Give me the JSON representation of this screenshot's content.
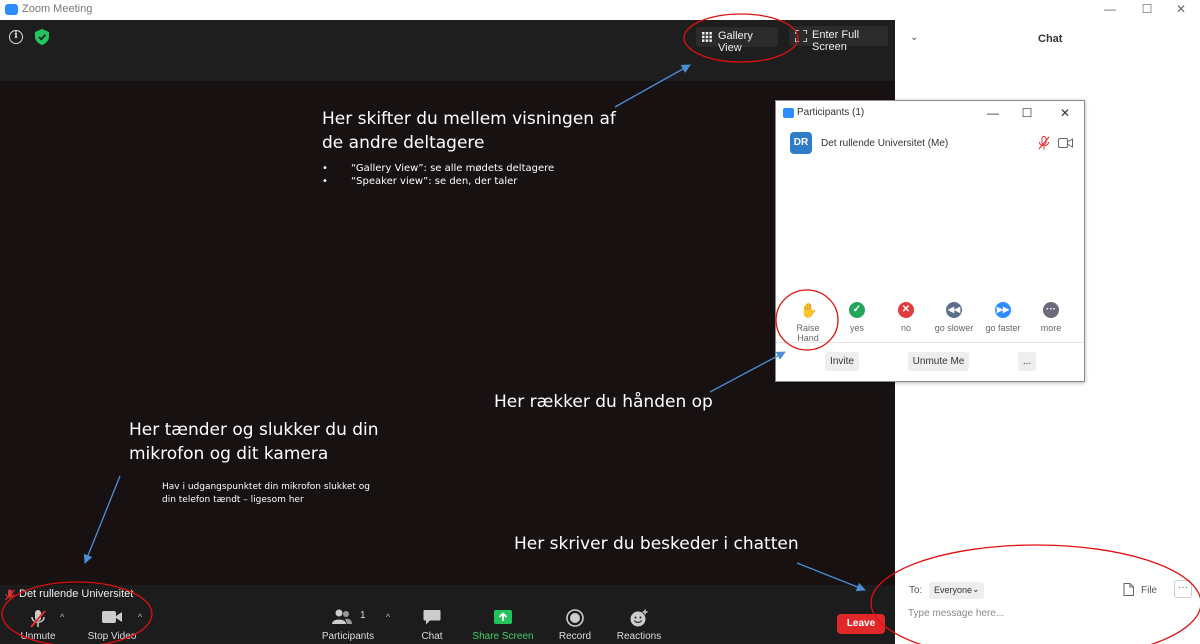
{
  "window": {
    "title": "Zoom Meeting",
    "min": "—",
    "max": "☐",
    "close": "✕"
  },
  "top_bar": {
    "gallery_view": "Gallery View",
    "full_screen": "Enter Full Screen"
  },
  "annotations": {
    "view_title": "Her skifter du mellem visningen af de andre deltagere",
    "view_bullets": [
      "“Gallery View”: se alle mødets deltagere",
      "“Speaker view”: se den, der taler"
    ],
    "hand": "Her rækker du hånden op",
    "mic_title": "Her tænder og slukker du din mikrofon og dit kamera",
    "mic_sub": "Hav i udgangspunktet din mikrofon slukket og din telefon tændt – ligesom her",
    "chat": "Her skriver du beskeder i chatten"
  },
  "self_name": "Det rullende Universitet",
  "toolbar": {
    "unmute": "Unmute",
    "stop_video": "Stop Video",
    "participants": "Participants",
    "participant_count": "1",
    "chat": "Chat",
    "share_screen": "Share Screen",
    "record": "Record",
    "reactions": "Reactions",
    "leave": "Leave"
  },
  "chat": {
    "title": "Chat",
    "to_label": "To:",
    "recipient": "Everyone",
    "file": "File",
    "more": "···",
    "placeholder": "Type message here..."
  },
  "participants": {
    "title": "Participants (1)",
    "list": [
      {
        "initials": "DR",
        "name": "Det rullende Universitet (Me)"
      }
    ],
    "feedback": [
      {
        "label": "Raise Hand",
        "color": "#2d8cff"
      },
      {
        "label": "yes",
        "color": "#23a55a"
      },
      {
        "label": "no",
        "color": "#e03c3c"
      },
      {
        "label": "go slower",
        "color": "#5b6e8c"
      },
      {
        "label": "go faster",
        "color": "#2d8cff"
      },
      {
        "label": "more",
        "color": "#6b6b7b"
      }
    ],
    "invite": "Invite",
    "unmute_me": "Unmute Me",
    "ellipsis": "..."
  },
  "colors": {
    "annotation_red": "#e01010",
    "arrow_blue": "#4a8fd6",
    "leave_red": "#e02828",
    "share_green": "#23c25a"
  }
}
